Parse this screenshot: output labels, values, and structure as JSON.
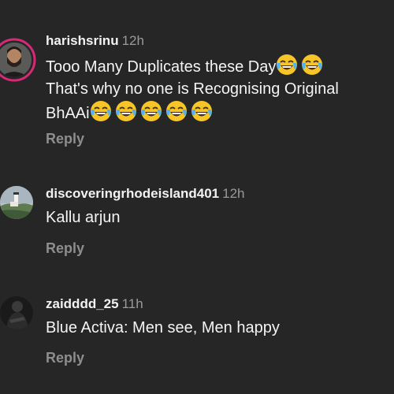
{
  "comments": [
    {
      "username": "harishsrinu",
      "time": "12h",
      "line1": "Tooo Many Duplicates these Day",
      "line2": "That's why no one is Recognising Original",
      "line3": "BhAAi",
      "reply_label": "Reply",
      "avatar_icon": "profile-photo-man-beard",
      "emoji_icon": "face-with-tears-of-joy"
    },
    {
      "username": "discoveringrhodeisland401",
      "time": "12h",
      "text": "Kallu arjun",
      "reply_label": "Reply",
      "avatar_icon": "profile-photo-lighthouse"
    },
    {
      "username": "zaidddd_25",
      "time": "11h",
      "text": "Blue Activa: Men see, Men happy",
      "reply_label": "Reply",
      "avatar_icon": "profile-photo-dark-figure"
    }
  ],
  "colors": {
    "background": "#262626",
    "username": "#f2f2f2",
    "timestamp": "#9a9a9a",
    "reply": "#8e8e8e",
    "story_ring": "#d62976"
  }
}
